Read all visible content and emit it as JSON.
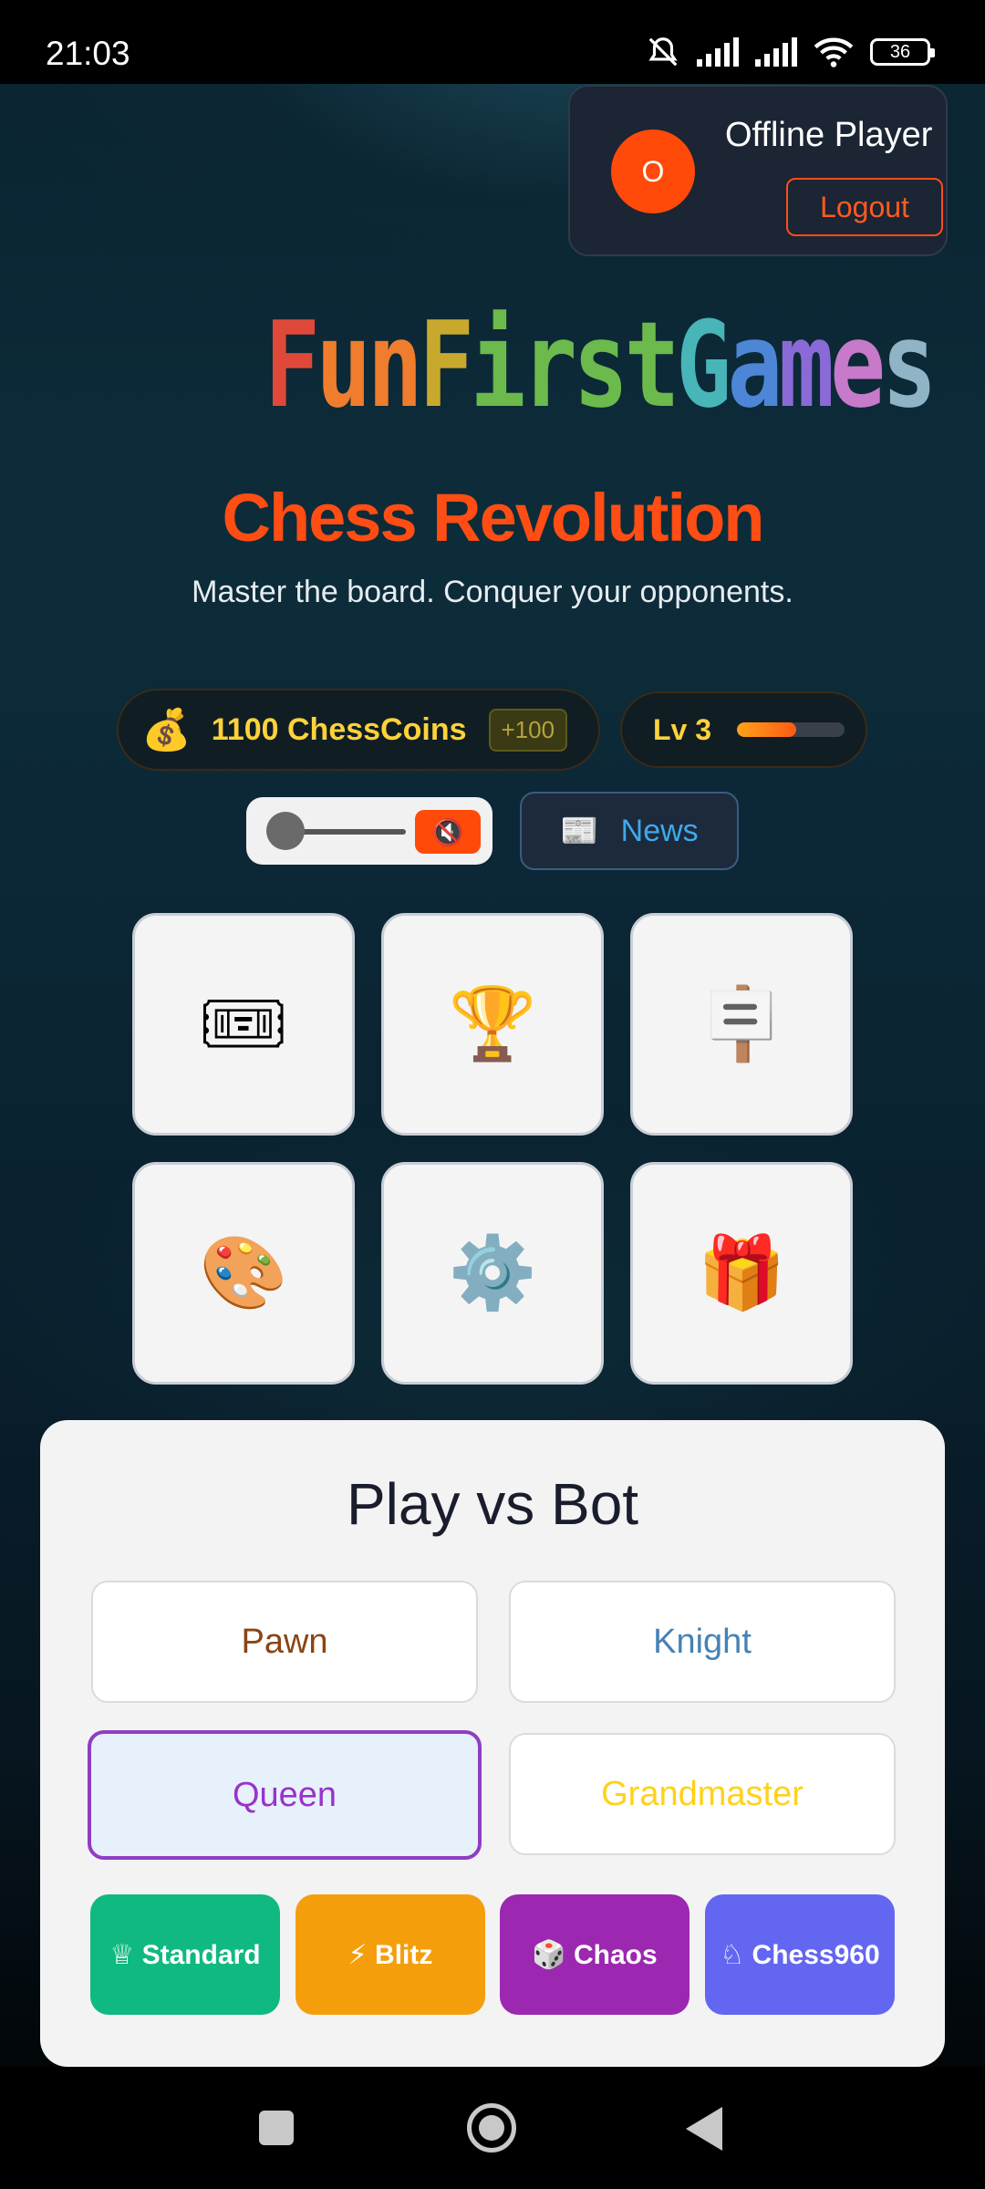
{
  "status_bar": {
    "time": "21:03",
    "battery": "36",
    "icons": [
      "bell-off-icon",
      "signal-icon",
      "signal-icon",
      "wifi-icon",
      "battery-icon"
    ]
  },
  "user": {
    "avatar_initial": "O",
    "name": "Offline Player",
    "logout_label": "Logout"
  },
  "logo": {
    "letters": [
      "F",
      "un",
      "F",
      "irst",
      "G",
      "a",
      "m",
      "e",
      "s"
    ]
  },
  "header": {
    "title": "Chess Revolution",
    "subtitle": "Master the board. Conquer your opponents."
  },
  "stats": {
    "coins_icon": "💰",
    "coins_text": "1100 ChessCoins",
    "coins_bonus": "+100",
    "level_text": "Lv 3",
    "xp_fraction": 0.55
  },
  "controls": {
    "mute_glyph": "🔇",
    "volume_fraction": 0.0,
    "news_icon": "📰",
    "news_label": "News"
  },
  "tiles": [
    {
      "glyph": "🎟",
      "icon": "ticket-icon"
    },
    {
      "glyph": "🏆",
      "icon": "trophy-icon"
    },
    {
      "glyph": "🪧",
      "icon": "shop-icon"
    },
    {
      "glyph": "🎨",
      "icon": "palette-icon"
    },
    {
      "glyph": "⚙️",
      "icon": "gear-icon"
    },
    {
      "glyph": "🎁",
      "icon": "gift-icon"
    }
  ],
  "bot_panel": {
    "title": "Play vs Bot",
    "difficulties": [
      {
        "label": "Pawn",
        "color": "#8b4513"
      },
      {
        "label": "Knight",
        "color": "#4682b4"
      },
      {
        "label": "Queen",
        "color": "#9932cc",
        "selected": true
      },
      {
        "label": "Grandmaster",
        "color": "#ffd21a"
      }
    ],
    "modes": [
      {
        "label": "♕ Standard",
        "color": "#10b981"
      },
      {
        "label": "⚡ Blitz",
        "color": "#f59e0b"
      },
      {
        "label": "🎲 Chaos",
        "color": "#9c27b0"
      },
      {
        "label": "♘ Chess960",
        "color": "#6366f1"
      }
    ]
  }
}
